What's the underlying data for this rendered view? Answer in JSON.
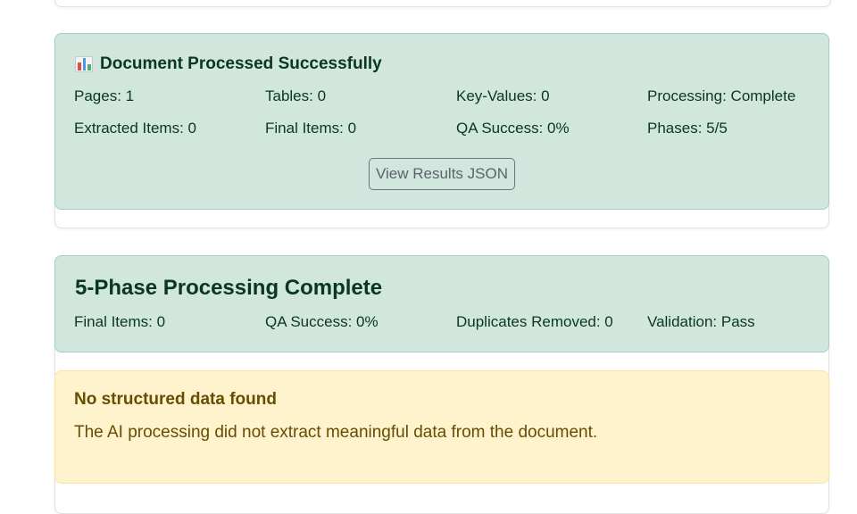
{
  "summary_card": {
    "icon": "bar-chart-icon",
    "title": "Document Processed Successfully",
    "stats": {
      "pages": "Pages: 1",
      "tables": "Tables: 0",
      "key_values": "Key-Values: 0",
      "processing": "Processing: Complete",
      "extracted_items": "Extracted Items: 0",
      "final_items": "Final Items: 0",
      "qa_success": "QA Success: 0%",
      "phases": "Phases: 5/5"
    },
    "view_json_label": "View Results JSON"
  },
  "phase_card": {
    "title": "5-Phase Processing Complete",
    "stats": {
      "final_items": "Final Items: 0",
      "qa_success": "QA Success: 0%",
      "duplicates_removed": "Duplicates Removed: 0",
      "validation": "Validation: Pass"
    }
  },
  "warning": {
    "title": "No structured data found",
    "message": "The AI processing did not extract meaningful data from the document."
  },
  "colors": {
    "success_bg": "#d1e7dd",
    "success_text": "#0a3622",
    "warning_bg": "#fff3cd",
    "warning_text": "#664d03"
  }
}
